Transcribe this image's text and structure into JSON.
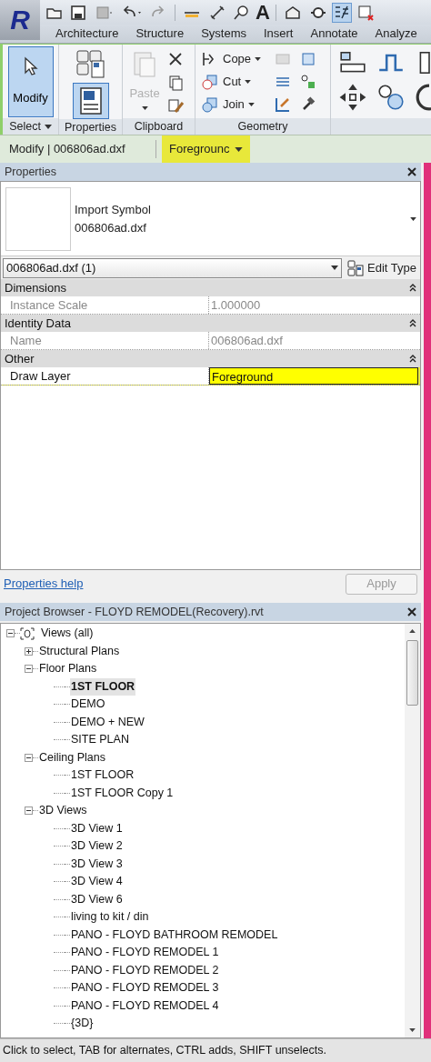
{
  "app_button": {
    "label": "R"
  },
  "quick_access": {
    "text_tool": "A"
  },
  "ribbon_tabs": [
    {
      "label": "Architecture",
      "selected": false
    },
    {
      "label": "Structure",
      "selected": false
    },
    {
      "label": "Systems",
      "selected": false
    },
    {
      "label": "Insert",
      "selected": false
    },
    {
      "label": "Annotate",
      "selected": false
    },
    {
      "label": "Analyze",
      "selected": false
    }
  ],
  "ribbon_panels": [
    {
      "kind": "select",
      "label": "Select",
      "button": {
        "label": "Modify",
        "selected": true
      }
    },
    {
      "kind": "properties",
      "label": "Properties",
      "button": {
        "selected": true
      }
    },
    {
      "kind": "clipboard",
      "label": "Clipboard",
      "paste": {
        "label": "Paste",
        "disabled": true
      }
    },
    {
      "kind": "geometry",
      "label": "Geometry",
      "tools": [
        "Cope",
        "Cut",
        "Join"
      ]
    },
    {
      "kind": "modify"
    }
  ],
  "options_bar": {
    "context": "Modify | 006806ad.dxf",
    "layer": {
      "value": "Foregrounc",
      "highlighted": true
    }
  },
  "properties": {
    "title": "Properties",
    "type_category": "Import Symbol",
    "type_name": "006806ad.dxf",
    "type_selector": "006806ad.dxf (1)",
    "edit_type": "Edit Type",
    "groups": [
      {
        "label": "Dimensions",
        "expanded": true,
        "rows": [
          {
            "label": "Instance Scale",
            "value": "1.000000",
            "disabled": true,
            "highlighted": false
          }
        ]
      },
      {
        "label": "Identity Data",
        "expanded": true,
        "rows": [
          {
            "label": "Name",
            "value": "006806ad.dxf",
            "disabled": true,
            "highlighted": false
          }
        ]
      },
      {
        "label": "Other",
        "expanded": true,
        "rows": [
          {
            "label": "Draw Layer",
            "value": "Foreground",
            "disabled": false,
            "highlighted": true
          }
        ]
      }
    ],
    "help_link": "Properties help",
    "apply": {
      "label": "Apply",
      "disabled": true
    }
  },
  "project_browser": {
    "title": "Project Browser - FLOYD REMODEL(Recovery).rvt",
    "tree": [
      {
        "label": "Views (all)",
        "expanded": true,
        "children": [
          {
            "label": "Structural Plans",
            "expanded": false
          },
          {
            "label": "Floor Plans",
            "expanded": true,
            "children": [
              {
                "label": "1ST FLOOR",
                "selected": true
              },
              {
                "label": "DEMO",
                "selected": false
              },
              {
                "label": "DEMO + NEW",
                "selected": false
              },
              {
                "label": "SITE PLAN",
                "selected": false
              }
            ]
          },
          {
            "label": "Ceiling Plans",
            "expanded": true,
            "children": [
              {
                "label": "1ST FLOOR",
                "selected": false
              },
              {
                "label": "1ST FLOOR Copy 1",
                "selected": false
              }
            ]
          },
          {
            "label": "3D Views",
            "expanded": true,
            "children": [
              {
                "label": "3D View 1",
                "selected": false
              },
              {
                "label": "3D View 2",
                "selected": false
              },
              {
                "label": "3D View 3",
                "selected": false
              },
              {
                "label": "3D View 4",
                "selected": false
              },
              {
                "label": "3D View 6",
                "selected": false
              },
              {
                "label": "living to kit / din",
                "selected": false
              },
              {
                "label": "PANO - FLOYD BATHROOM REMODEL",
                "selected": false
              },
              {
                "label": "PANO - FLOYD REMODEL 1",
                "selected": false
              },
              {
                "label": "PANO - FLOYD REMODEL 2",
                "selected": false
              },
              {
                "label": "PANO - FLOYD REMODEL 3",
                "selected": false
              },
              {
                "label": "PANO - FLOYD REMODEL 4",
                "selected": false
              },
              {
                "label": "{3D}",
                "selected": false
              }
            ]
          }
        ]
      }
    ]
  },
  "status_bar": "Click to select, TAB for alternates, CTRL adds, SHIFT unselects."
}
